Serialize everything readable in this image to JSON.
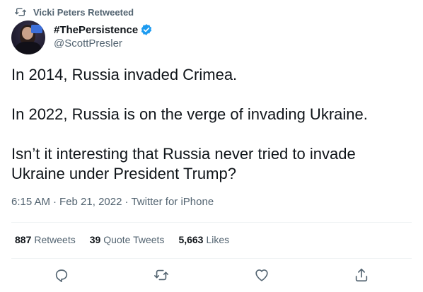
{
  "retweet_context": {
    "icon": "retweet-icon",
    "text": "Vicki Peters Retweeted"
  },
  "author": {
    "display_name": "#ThePersistence",
    "handle": "@ScottPresler",
    "verified_icon": "verified-badge-icon",
    "accent_color": "#1d9bf0"
  },
  "tweet": {
    "paragraphs": [
      "In 2014, Russia invaded Crimea.",
      "In 2022, Russia is on the verge of invading Ukraine.",
      "Isn’t it interesting that Russia never tried to invade Ukraine under President Trump?"
    ],
    "time": "6:15 AM",
    "date": "Feb 21, 2022",
    "source": "Twitter for iPhone",
    "separator": "·"
  },
  "stats": {
    "retweets": {
      "count": "887",
      "label": "Retweets"
    },
    "quote_tweets": {
      "count": "39",
      "label": "Quote Tweets"
    },
    "likes": {
      "count": "5,663",
      "label": "Likes"
    }
  },
  "actions": [
    {
      "name": "reply",
      "icon": "reply-icon"
    },
    {
      "name": "retweet",
      "icon": "retweet-icon"
    },
    {
      "name": "like",
      "icon": "heart-icon"
    },
    {
      "name": "share",
      "icon": "share-icon"
    }
  ]
}
